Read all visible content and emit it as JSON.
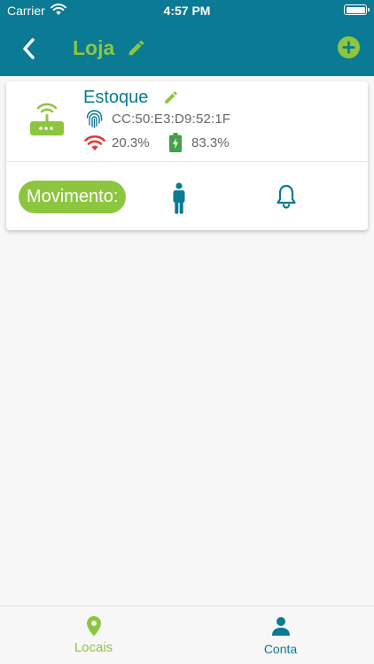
{
  "status_bar": {
    "carrier": "Carrier",
    "time": "4:57 PM"
  },
  "nav": {
    "title": "Loja",
    "back_icon": "chevron-left-icon",
    "edit_icon": "pencil-icon",
    "add_icon": "plus-circle-icon"
  },
  "device": {
    "name": "Estoque",
    "mac": "CC:50:E3:D9:52:1F",
    "signal": "20.3%",
    "battery": "83.3%",
    "movement_label": "Movimento:"
  },
  "tabs": [
    {
      "label": "Locais",
      "icon": "location-pin-icon"
    },
    {
      "label": "Conta",
      "icon": "person-icon"
    }
  ],
  "colors": {
    "primary": "#0b7a94",
    "accent": "#8cc63f",
    "signal": "#e53935",
    "battery": "#43a047"
  }
}
